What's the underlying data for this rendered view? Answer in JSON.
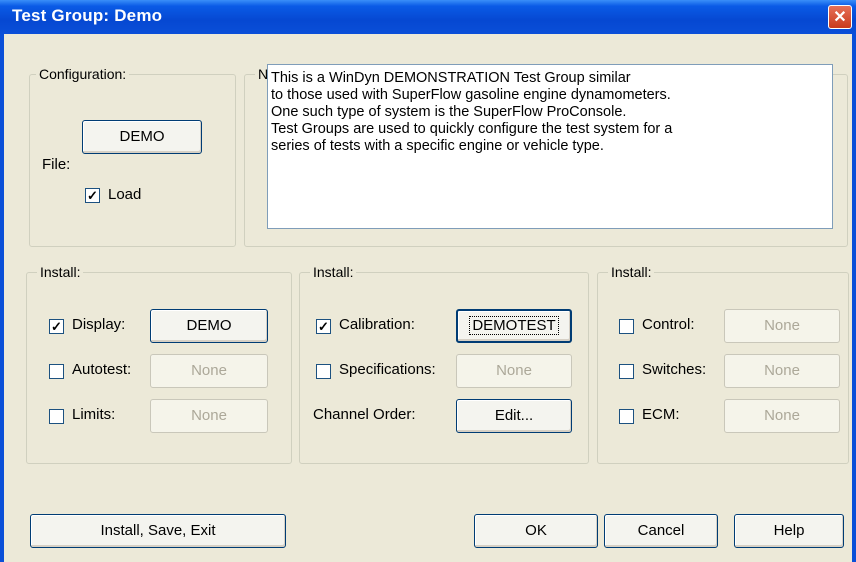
{
  "window": {
    "title": "Test Group:  Demo",
    "close_glyph": "✕"
  },
  "configuration": {
    "legend": "Configuration:",
    "file_label": "File:",
    "file_button": "DEMO",
    "load_label": "Load",
    "load_checked": true
  },
  "notes": {
    "legend": "Notes:",
    "lines": [
      "This is a WinDyn DEMONSTRATION Test Group similar",
      "to those used with SuperFlow gasoline engine dynamometers.",
      "One such type of system is the SuperFlow ProConsole.",
      "Test Groups are used to quickly configure the test system for a",
      "series of tests with a specific engine or vehicle type."
    ]
  },
  "install_left": {
    "legend": "Install:",
    "rows": [
      {
        "label": "Display:",
        "checked": true,
        "button": "DEMO",
        "enabled": true
      },
      {
        "label": "Autotest:",
        "checked": false,
        "button": "None",
        "enabled": false
      },
      {
        "label": "Limits:",
        "checked": false,
        "button": "None",
        "enabled": false
      }
    ]
  },
  "install_mid": {
    "legend": "Install:",
    "rows": [
      {
        "label": "Calibration:",
        "checked": true,
        "button": "DEMOTEST",
        "enabled": true
      },
      {
        "label": "Specifications:",
        "checked": false,
        "button": "None",
        "enabled": false
      }
    ],
    "channel_order_label": "Channel Order:",
    "channel_order_button": "Edit..."
  },
  "install_right": {
    "legend": "Install:",
    "rows": [
      {
        "label": "Control:",
        "checked": false,
        "button": "None",
        "enabled": false
      },
      {
        "label": "Switches:",
        "checked": false,
        "button": "None",
        "enabled": false
      },
      {
        "label": "ECM:",
        "checked": false,
        "button": "None",
        "enabled": false
      }
    ]
  },
  "footer": {
    "install_save_exit": "Install, Save, Exit",
    "ok": "OK",
    "cancel": "Cancel",
    "help": "Help"
  }
}
